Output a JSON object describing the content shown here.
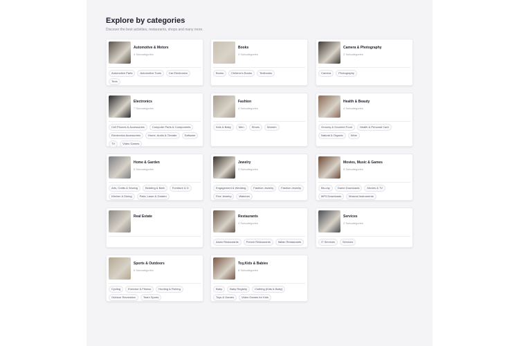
{
  "page": {
    "title": "Explore by categories",
    "subtitle": "Discover the best activities, restaurants, shops and many more."
  },
  "categories": [
    {
      "name": "Automotive & Motors",
      "count": "4 Subcategories",
      "color": "#5a5248",
      "tags": [
        "Automotive Parts",
        "Automotive Tools",
        "Car Electronics",
        "Tires"
      ]
    },
    {
      "name": "Books",
      "count": "3 Subcategories",
      "color": "#c9c1b3",
      "tags": [
        "Books",
        "Children's Books",
        "Textbooks"
      ]
    },
    {
      "name": "Camera & Photography",
      "count": "2 Subcategories",
      "color": "#3f3a35",
      "tags": [
        "Camera",
        "Photography"
      ]
    },
    {
      "name": "Electronics",
      "count": "7 Subcategories",
      "color": "#2a2b2e",
      "tags": [
        "Cell Phones & Accessories",
        "Computer Parts & Components",
        "Electronics Accessories",
        "Home, Audio & Theater",
        "Software",
        "TV",
        "Video Games"
      ]
    },
    {
      "name": "Fashion",
      "count": "4 Subcategories",
      "color": "#a89f93",
      "tags": [
        "Kids & Baby",
        "Men",
        "Shoes",
        "Women"
      ]
    },
    {
      "name": "Health & Beauty",
      "count": "4 Subcategories",
      "color": "#8a6a55",
      "tags": [
        "Grocery & Gourmet Food",
        "Health & Personal Care",
        "Natural & Organic",
        "Wine"
      ]
    },
    {
      "name": "Home & Garden",
      "count": "5 Subcategories",
      "color": "#7e7f84",
      "tags": [
        "Arts, Crafts & Sewing",
        "Bedding & Bath",
        "Furniture & D",
        "Kitchen & Dining",
        "Patio, Lawn & Garden"
      ]
    },
    {
      "name": "Jewelry",
      "count": "3 Subcategories",
      "color": "#3a332e",
      "tags": [
        "Engagement & Wedding",
        "Fashion Jewelry",
        "Fashion Jewelry",
        "Fine Jewelry",
        "Watches"
      ]
    },
    {
      "name": "Movies, Music & Games",
      "count": "5 Subcategories",
      "color": "#6d4a36",
      "tags": [
        "Blu-ray",
        "Game Downloads",
        "Movies & TV",
        "MP3 Downloads",
        "Musical Instruments"
      ]
    },
    {
      "name": "Real Estate",
      "count": "",
      "color": "#8c8b86",
      "tags": []
    },
    {
      "name": "Restaurants",
      "count": "3 Subcategories",
      "color": "#6b5a4c",
      "tags": [
        "Asian Restaurants",
        "French Restaurants",
        "Italian Restaurants"
      ]
    },
    {
      "name": "Services",
      "count": "2 Subcategories",
      "color": "#4a4d55",
      "tags": [
        "IT Services",
        "Services"
      ]
    },
    {
      "name": "Sports & Outdoors",
      "count": "5 Subcategories",
      "color": "#b4a890",
      "tags": [
        "Cycling",
        "Exercise & Fitness",
        "Hunting & Fishing",
        "Outdoor Recreation",
        "Team Sports"
      ]
    },
    {
      "name": "Toy,Kids & Babies",
      "count": "6 Subcategories",
      "color": "#7a5846",
      "tags": [
        "Baby",
        "Baby Registry",
        "Clothing (Kids & Baby)",
        "Toys & Games",
        "Video Games for Kids"
      ]
    }
  ]
}
